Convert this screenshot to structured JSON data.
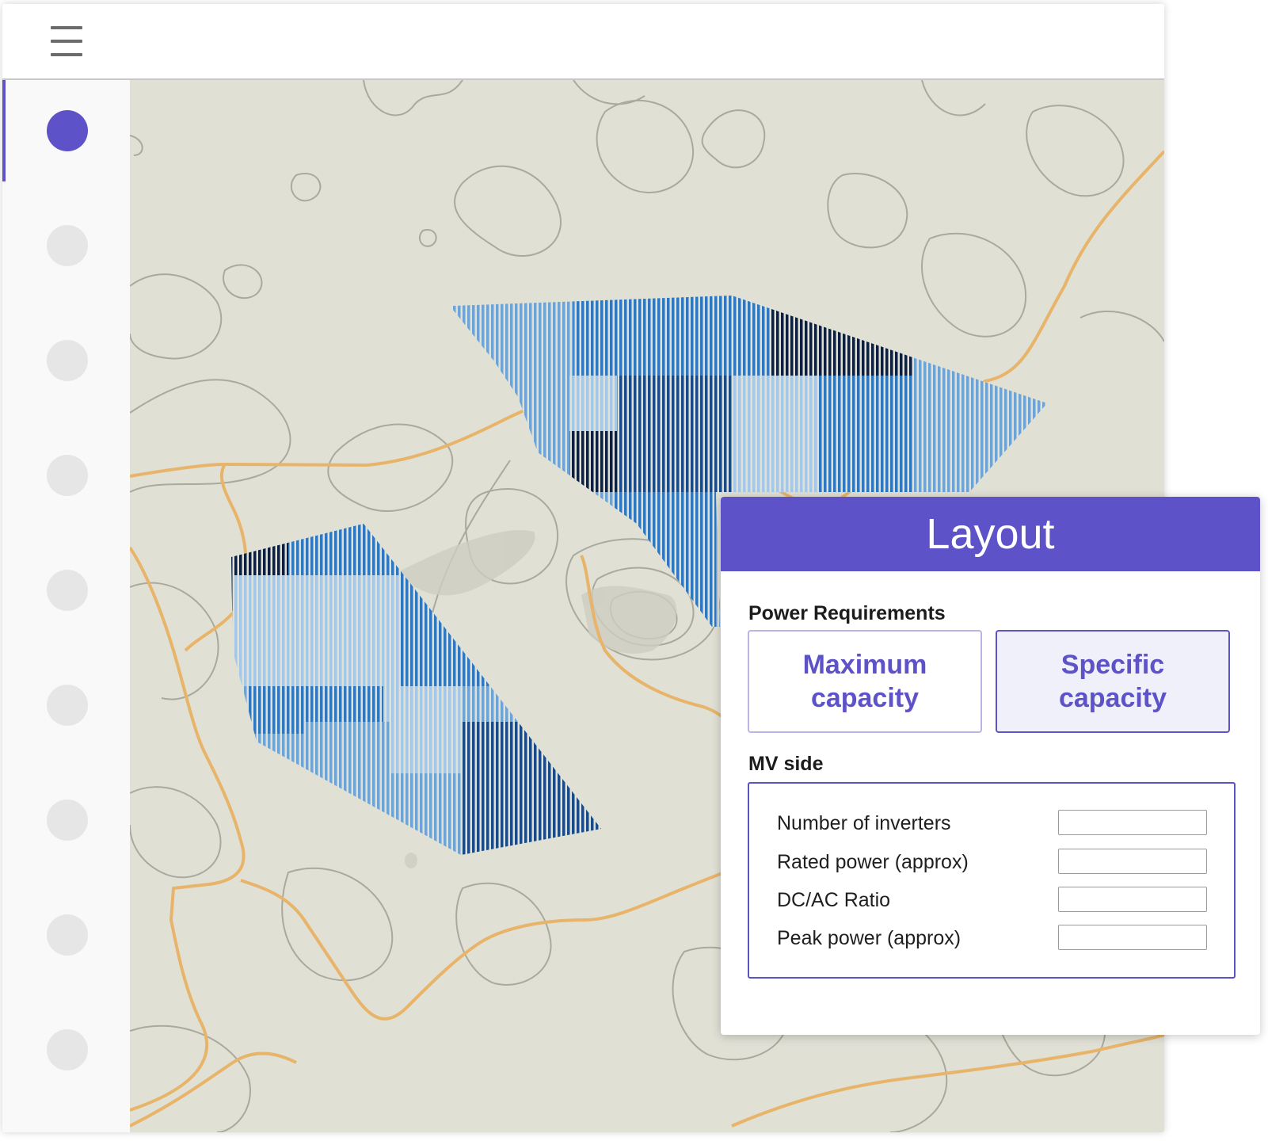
{
  "topbar": {
    "menu_icon": "hamburger-menu-icon"
  },
  "sidebar": {
    "items": [
      {
        "state": "active"
      },
      {
        "state": "inactive"
      },
      {
        "state": "inactive"
      },
      {
        "state": "inactive"
      },
      {
        "state": "inactive"
      },
      {
        "state": "inactive"
      },
      {
        "state": "inactive"
      },
      {
        "state": "inactive"
      },
      {
        "state": "inactive"
      }
    ],
    "active_color": "#5e52c8",
    "inactive_color": "#e6e6e6"
  },
  "map": {
    "background_color": "#e0e0d5",
    "road_color": "#e8b46a",
    "contour_color": "#a9a99d",
    "array_colors": [
      "#0d1f3c",
      "#1a4b86",
      "#2f78bf",
      "#6ea3d6",
      "#a6c8e8"
    ]
  },
  "layout_panel": {
    "title": "Layout",
    "power_requirements": {
      "label": "Power Requirements",
      "options": [
        "Maximum\ncapacity",
        "Specific\ncapacity"
      ],
      "selected": "Specific\ncapacity"
    },
    "mv_side": {
      "label": "MV side",
      "fields": [
        {
          "label": "Number of inverters",
          "value": ""
        },
        {
          "label": "Rated power (approx)",
          "value": ""
        },
        {
          "label": "DC/AC Ratio",
          "value": ""
        },
        {
          "label": "Peak power (approx)",
          "value": ""
        }
      ]
    },
    "accent_color": "#5e52c8"
  }
}
